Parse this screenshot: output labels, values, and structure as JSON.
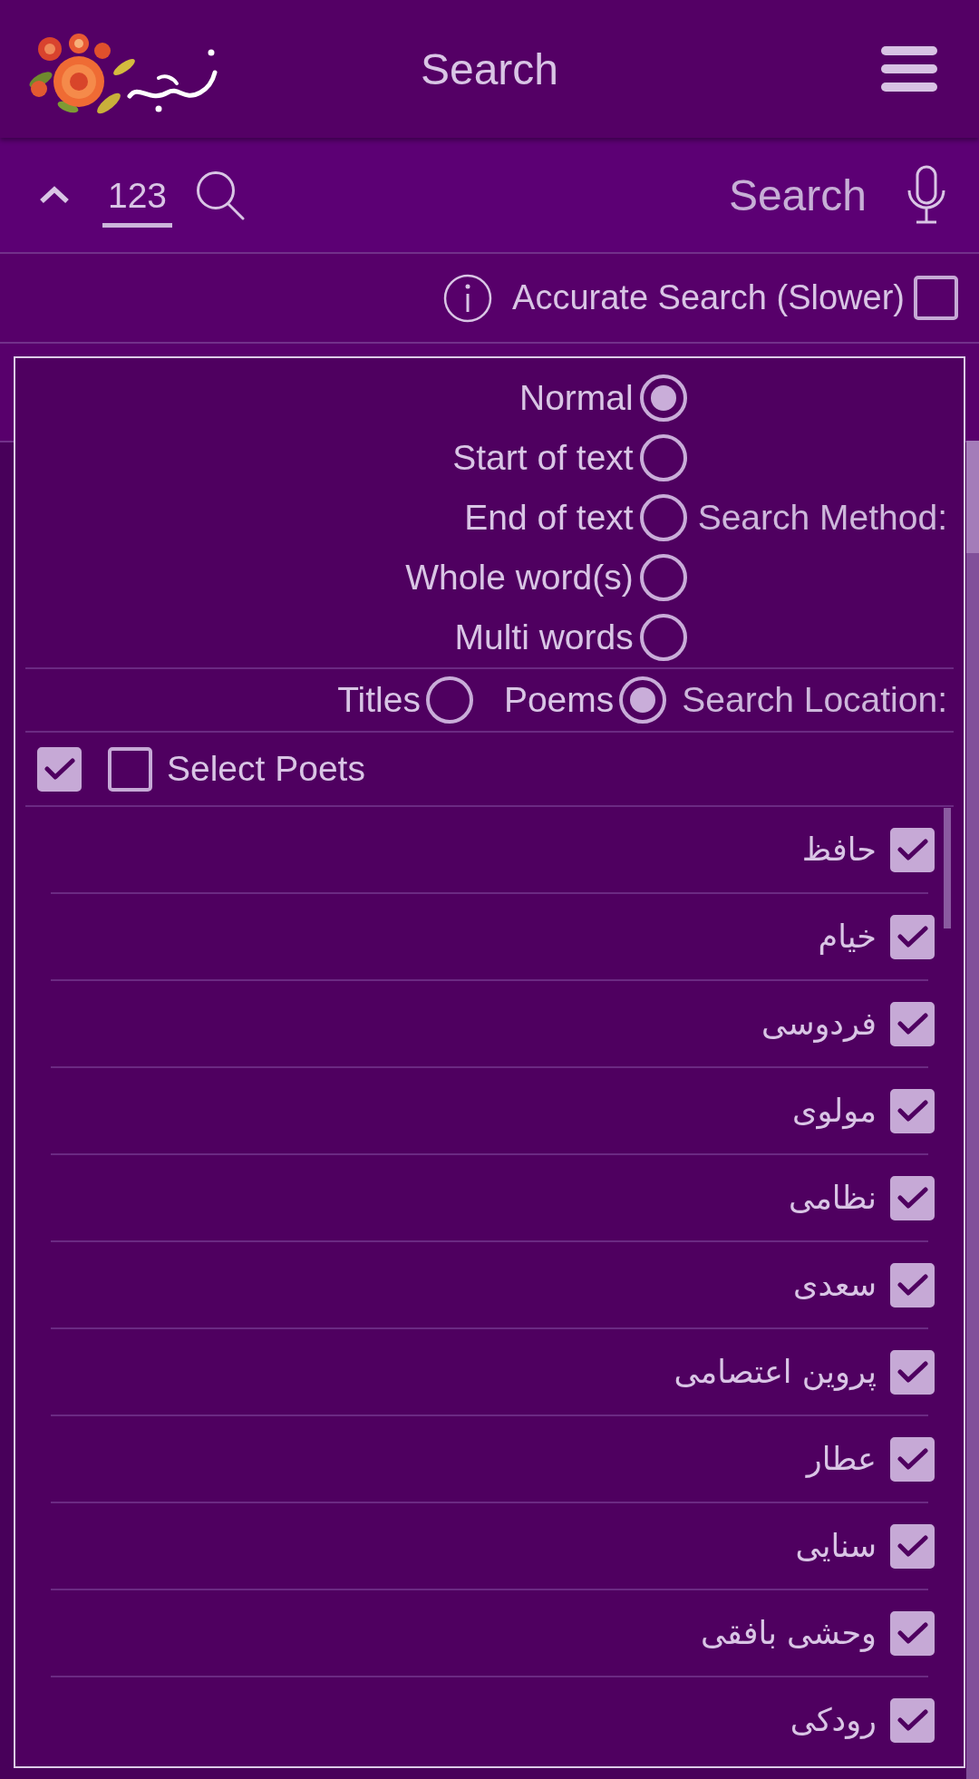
{
  "header": {
    "title": "Search"
  },
  "search_bar": {
    "number_field": {
      "value": "123"
    },
    "search_field": {
      "placeholder": "Search"
    }
  },
  "accurate_search": {
    "label": "Accurate Search (Slower)",
    "checked": false
  },
  "dialog": {
    "search_method": {
      "label": "Search Method:",
      "options": [
        {
          "label": "Normal",
          "selected": true
        },
        {
          "label": "Start of text",
          "selected": false
        },
        {
          "label": "End of text",
          "selected": false
        },
        {
          "label": "Whole word(s)",
          "selected": false
        },
        {
          "label": "Multi words",
          "selected": false
        }
      ]
    },
    "search_location": {
      "label": "Search Location:",
      "options": [
        {
          "label": "Poems",
          "selected": true
        },
        {
          "label": "Titles",
          "selected": false
        }
      ]
    },
    "select_all": {
      "checked": true
    },
    "select_poets": {
      "label": "Select Poets",
      "checked": false
    },
    "poets": [
      {
        "name": "حافظ",
        "checked": true
      },
      {
        "name": "خیام",
        "checked": true
      },
      {
        "name": "فردوسی",
        "checked": true
      },
      {
        "name": "مولوی",
        "checked": true
      },
      {
        "name": "نظامی",
        "checked": true
      },
      {
        "name": "سعدی",
        "checked": true
      },
      {
        "name": "پروین اعتصامی",
        "checked": true
      },
      {
        "name": "عطار",
        "checked": true
      },
      {
        "name": "سنایی",
        "checked": true
      },
      {
        "name": "وحشی بافقی",
        "checked": true
      },
      {
        "name": "رودکی",
        "checked": true
      }
    ]
  }
}
